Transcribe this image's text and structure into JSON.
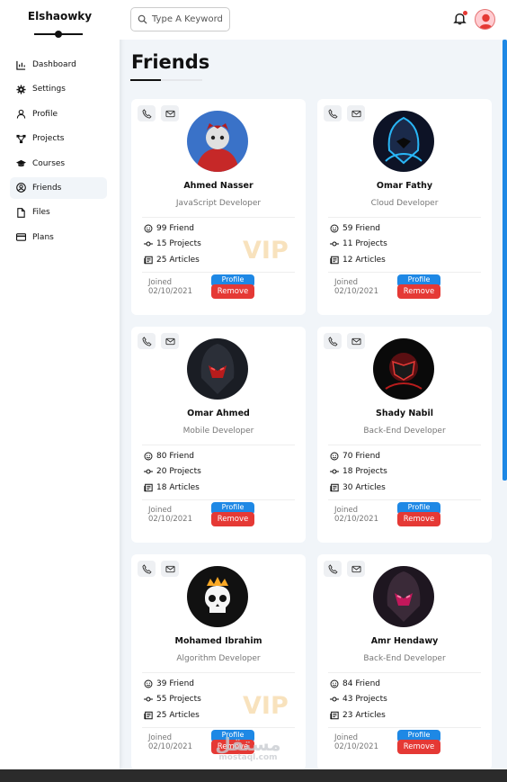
{
  "sidebar": {
    "brand": "Elshaowky",
    "items": [
      {
        "label": "Dashboard",
        "icon": "chart-icon"
      },
      {
        "label": "Settings",
        "icon": "gear-icon"
      },
      {
        "label": "Profile",
        "icon": "user-icon"
      },
      {
        "label": "Projects",
        "icon": "diagram-icon"
      },
      {
        "label": "Courses",
        "icon": "graduation-cap-icon"
      },
      {
        "label": "Friends",
        "icon": "friends-icon",
        "active": true
      },
      {
        "label": "Files",
        "icon": "file-icon"
      },
      {
        "label": "Plans",
        "icon": "credit-card-icon"
      }
    ]
  },
  "header": {
    "search_placeholder": "Type A Keyword",
    "notification_badge_color": "#e53935"
  },
  "page": {
    "title": "Friends"
  },
  "cards": [
    {
      "name": "Ahmed Nasser",
      "role": "JavaScript Developer",
      "friends": "99 Friend",
      "projects": "15 Projects",
      "articles": "25 Articles",
      "joined_label": "Joined",
      "joined_date": "02/10/2021",
      "profile_label": "Profile",
      "remove_label": "Remove",
      "vip": "VIP"
    },
    {
      "name": "Omar Fathy",
      "role": "Cloud Developer",
      "friends": "59 Friend",
      "projects": "11 Projects",
      "articles": "12 Articles",
      "joined_label": "Joined",
      "joined_date": "02/10/2021",
      "profile_label": "Profile",
      "remove_label": "Remove"
    },
    {
      "name": "Omar Ahmed",
      "role": "Mobile Developer",
      "friends": "80 Friend",
      "projects": "20 Projects",
      "articles": "18 Articles",
      "joined_label": "Joined",
      "joined_date": "02/10/2021",
      "profile_label": "Profile",
      "remove_label": "Remove"
    },
    {
      "name": "Shady Nabil",
      "role": "Back-End Developer",
      "friends": "70 Friend",
      "projects": "18 Projects",
      "articles": "30 Articles",
      "joined_label": "Joined",
      "joined_date": "02/10/2021",
      "profile_label": "Profile",
      "remove_label": "Remove"
    },
    {
      "name": "Mohamed Ibrahim",
      "role": "Algorithm Developer",
      "friends": "39 Friend",
      "projects": "55 Projects",
      "articles": "25 Articles",
      "joined_label": "Joined",
      "joined_date": "02/10/2021",
      "profile_label": "Profile",
      "remove_label": "Remove",
      "vip": "VIP"
    },
    {
      "name": "Amr Hendawy",
      "role": "Back-End Developer",
      "friends": "84 Friend",
      "projects": "43 Projects",
      "articles": "23 Articles",
      "joined_label": "Joined",
      "joined_date": "02/10/2021",
      "profile_label": "Profile",
      "remove_label": "Remove"
    }
  ],
  "watermark": {
    "arabic": "مستقل",
    "text": "mostaql.com"
  },
  "colors": {
    "primary": "#1e88e5",
    "danger": "#e53935",
    "vip": "#f6d9a8"
  }
}
